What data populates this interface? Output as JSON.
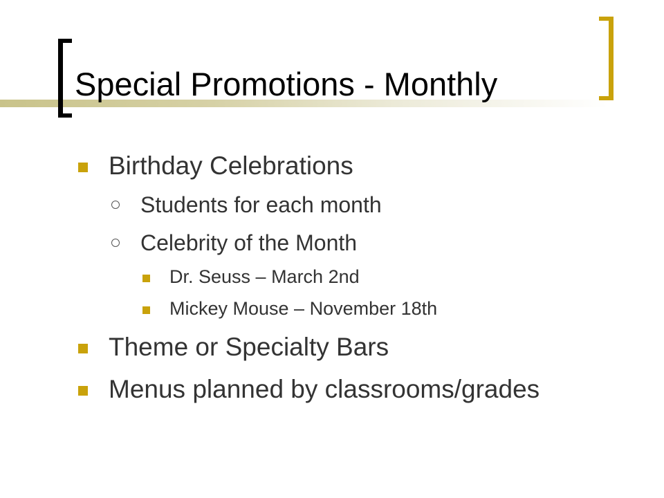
{
  "slide": {
    "title": "Special Promotions - Monthly",
    "items": [
      {
        "level": 1,
        "text": "Birthday Celebrations"
      },
      {
        "level": 2,
        "text": "Students for each month"
      },
      {
        "level": 2,
        "text": "Celebrity of the Month"
      },
      {
        "level": 3,
        "text": "Dr. Seuss – March 2nd"
      },
      {
        "level": 3,
        "text": "Mickey Mouse – November 18th"
      },
      {
        "level": 1,
        "text": "Theme or Specialty Bars"
      },
      {
        "level": 1,
        "text": "Menus planned by classrooms/grades"
      }
    ]
  },
  "colors": {
    "accent": "#c9a20b",
    "title_text": "#000000",
    "body_text": "#333333",
    "left_bracket": "#000000"
  },
  "icons": {
    "level1_bullet": "square-bullet-icon",
    "level2_bullet": "hollow-circle-bullet-icon",
    "level3_bullet": "square-bullet-icon"
  }
}
